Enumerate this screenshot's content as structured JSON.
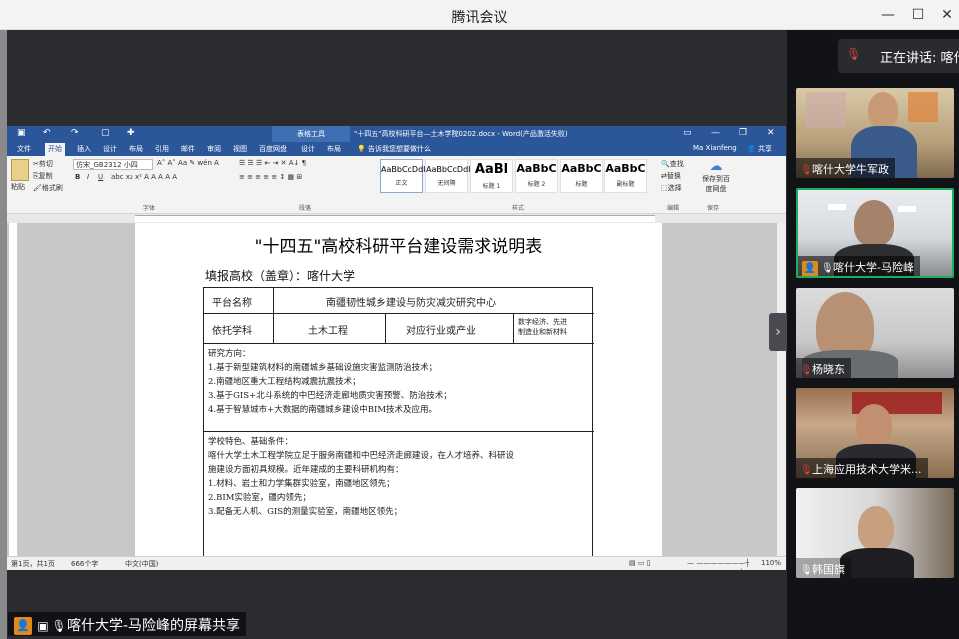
{
  "app": {
    "title": "腾讯会议"
  },
  "window_controls": {
    "minimize": "—",
    "maximize": "☐",
    "close": "✕"
  },
  "word": {
    "title": "\"十四五\"高校科研平台—土木学院0202.docx - Word(产品激活失败)",
    "context_tab": "表格工具",
    "tabs": [
      "文件",
      "开始",
      "插入",
      "设计",
      "布局",
      "引用",
      "邮件",
      "审阅",
      "视图",
      "百度网盘",
      "设计",
      "布局"
    ],
    "tell_me": "告诉我您想要做什么",
    "user": "Ma Xianfeng",
    "share": "共享",
    "clipboard": {
      "paste": "粘贴",
      "cut": "剪切",
      "copy": "复制",
      "format_painter": "格式刷"
    },
    "font_name": "仿宋_GB2312",
    "font_size": "小四",
    "groups": [
      "字体",
      "段落",
      "样式",
      "编辑",
      "保存"
    ],
    "styles": [
      {
        "sample": "AaBbCcDdI",
        "name": "正文",
        "big": false
      },
      {
        "sample": "AaBbCcDdI",
        "name": "无间隔",
        "big": false
      },
      {
        "sample": "AaBl",
        "name": "标题 1",
        "big": true
      },
      {
        "sample": "AaBbC",
        "name": "标题 2",
        "big": true
      },
      {
        "sample": "AaBbC",
        "name": "标题",
        "big": true
      },
      {
        "sample": "AaBbC",
        "name": "副标题",
        "big": true
      }
    ],
    "editing": {
      "find": "查找",
      "replace": "替换",
      "select": "选择"
    },
    "save_baidu": "保存到百度网盘",
    "document": {
      "title": "\"十四五\"高校科研平台建设需求说明表",
      "fill_line": "填报高校（盖章）：喀什大学",
      "table": {
        "platform_label": "平台名称",
        "platform_value": "南疆韧性城乡建设与防灾减灾研究中心",
        "discipline_label": "依托学科",
        "discipline_value": "土木工程",
        "industry_label": "对应行业或产业",
        "industry_value_1": "数字经济、先进",
        "industry_value_2": "制造业和新材料",
        "research_lines": [
          "研究方向：",
          "1.基于新型建筑材料的南疆城乡基础设施灾害监测防治技术；",
          "2.南疆地区重大工程结构减震抗震技术；",
          "3.基于GIS+北斗系统的中巴经济走廊地质灾害预警、防治技术；",
          "4.基于智慧城市+大数据的南疆城乡建设中BIM技术及应用。"
        ],
        "basis_lines": [
          "学校特色、基础条件：",
          "喀什大学土木工程学院立足于服务南疆和中巴经济走廊建设，在人才培养、科研设",
          "施建设方面初具规模。近年建成的主要科研机构有：",
          "1.材料、岩土和力学集群实验室，南疆地区领先；",
          "2.BIM实验室，疆内领先；",
          "3.配备无人机、GIS的测量实验室，南疆地区领先；"
        ]
      }
    },
    "status": {
      "page": "第1页，共1页",
      "words": "666个字",
      "language": "中文(中国)",
      "zoom": "110%"
    }
  },
  "presenter_label": "喀什大学-马险峰的屏幕共享",
  "speaking": {
    "label": "正在讲话: 喀什"
  },
  "participants": [
    {
      "name": "喀什大学牛军政",
      "muted": true,
      "active": false,
      "host_icon": false
    },
    {
      "name": "喀什大学-马险峰",
      "muted": false,
      "active": true,
      "host_icon": true
    },
    {
      "name": "杨晓东",
      "muted": true,
      "active": false,
      "host_icon": false
    },
    {
      "name": "上海应用技术大学米...",
      "muted": true,
      "active": false,
      "host_icon": false
    },
    {
      "name": "韩国旗",
      "muted": false,
      "active": false,
      "host_icon": false
    }
  ]
}
